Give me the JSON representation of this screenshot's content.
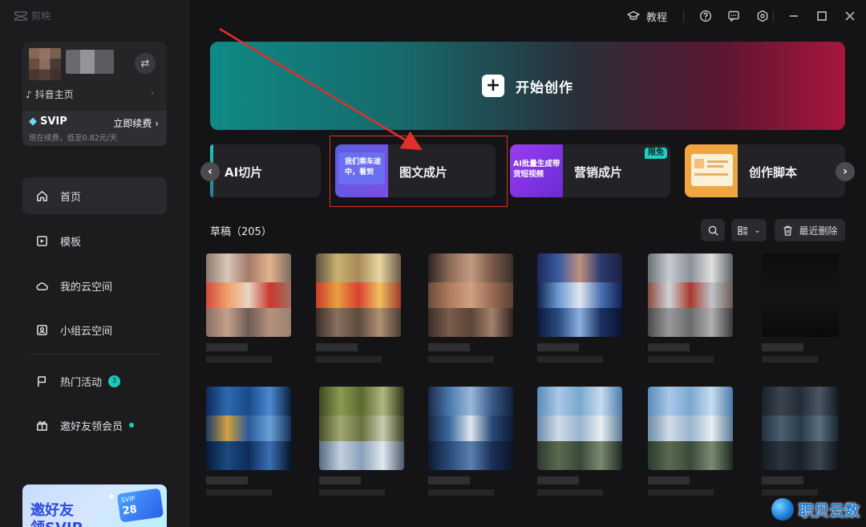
{
  "app": {
    "logo_text": "剪映"
  },
  "titlebar": {
    "tutorial_label": "教程"
  },
  "user": {
    "douyin_label": "抖音主页",
    "svip_label": "SVIP",
    "renew_label": "立即续费",
    "renew_sub": "现在续费，低至0.82元/天"
  },
  "hero": {
    "label": "开始创作"
  },
  "features": [
    {
      "label": "AI切片"
    },
    {
      "label": "图文成片",
      "thumb_text": "我们乘车途中，看到"
    },
    {
      "label": "营销成片",
      "thumb_text": "AI批量生成带货短视频",
      "badge": "限免"
    },
    {
      "label": "创作脚本"
    }
  ],
  "drafts": {
    "title": "草稿（205）",
    "recent_delete_label": "最近删除"
  },
  "nav": [
    {
      "label": "首页"
    },
    {
      "label": "模板"
    },
    {
      "label": "我的云空间"
    },
    {
      "label": "小组云空间"
    },
    {
      "label": "热门活动",
      "badge": "3"
    },
    {
      "label": "邀好友领会员"
    }
  ],
  "promo": {
    "text": "邀好友\n领SVIP",
    "card_label": "SVIP",
    "card_value": "28"
  },
  "watermark": {
    "text": "职贝云数"
  },
  "colors": {
    "accent": "#1fc9b8",
    "highlight": "#e0302a",
    "background": "#141416",
    "sidebar": "#1c1c1f"
  }
}
